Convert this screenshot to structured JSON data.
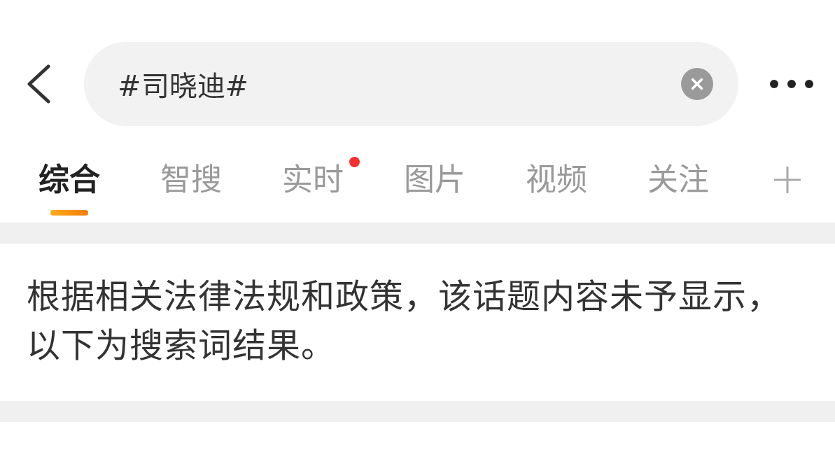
{
  "header": {
    "search": {
      "value": "#司晓迪#"
    }
  },
  "tabs": [
    {
      "label": "综合",
      "selected": true,
      "dot": false
    },
    {
      "label": "智搜",
      "selected": false,
      "dot": false
    },
    {
      "label": "实时",
      "selected": false,
      "dot": true
    },
    {
      "label": "图片",
      "selected": false,
      "dot": false
    },
    {
      "label": "视频",
      "selected": false,
      "dot": false
    },
    {
      "label": "关注",
      "selected": false,
      "dot": false
    }
  ],
  "notice": "根据相关法律法规和政策，该话题内容未予显示，以下为搜索词结果。"
}
